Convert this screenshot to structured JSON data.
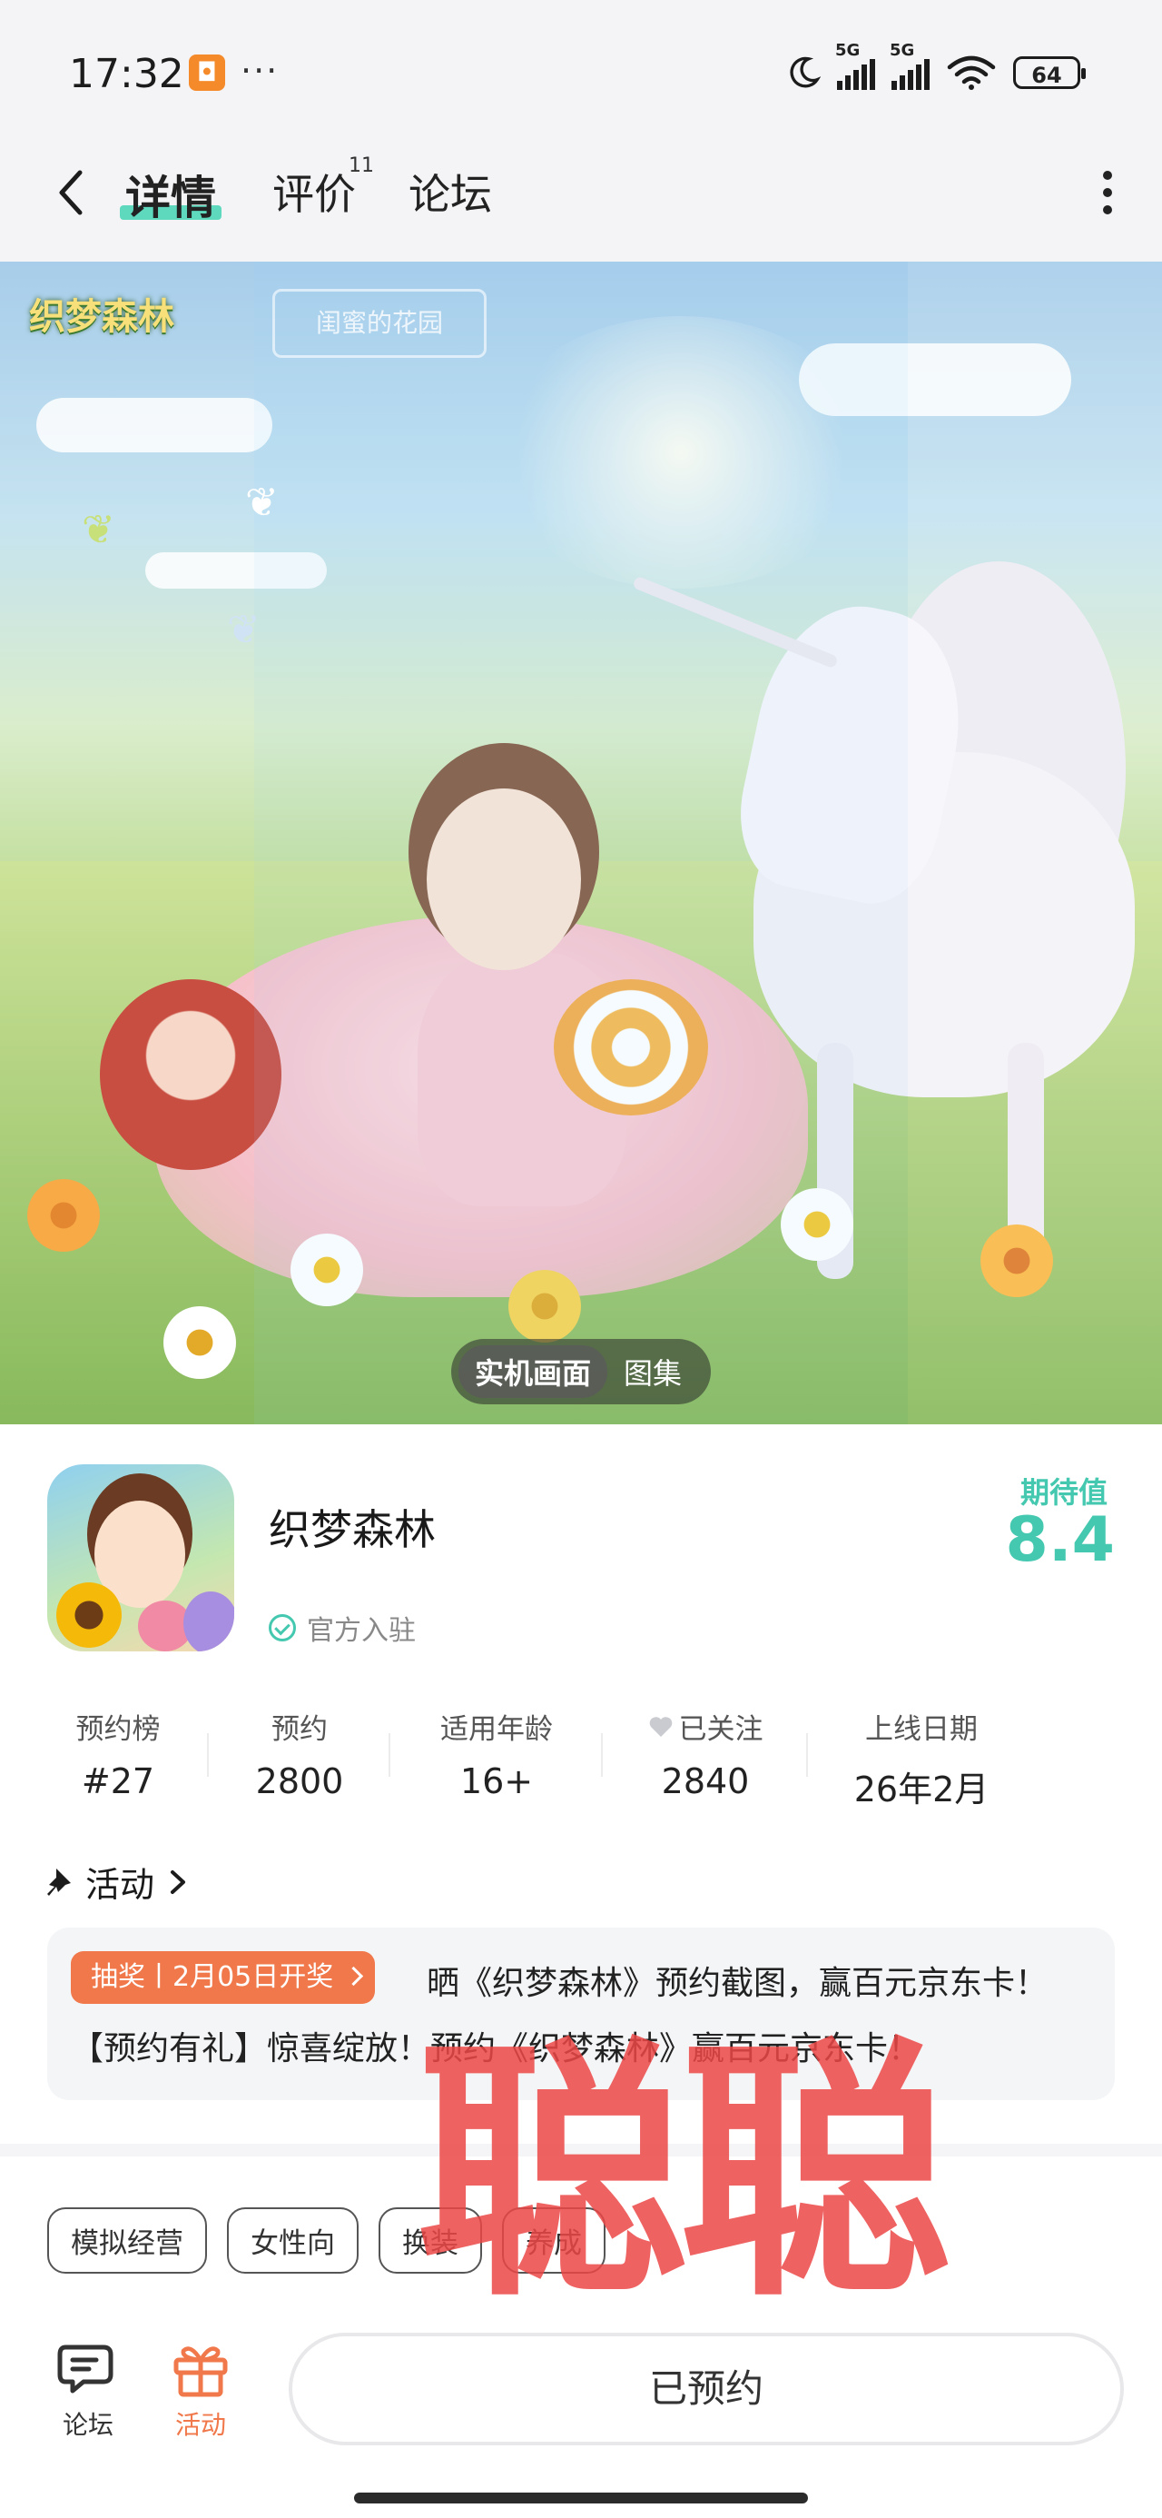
{
  "status_bar": {
    "time": "17:32",
    "signal1": "5G",
    "signal2": "5G",
    "battery": "64"
  },
  "nav": {
    "tabs": [
      {
        "label": "详情",
        "active": true
      },
      {
        "label": "评价",
        "badge": "11"
      },
      {
        "label": "论坛"
      }
    ]
  },
  "hero": {
    "logo_text": "织梦森林",
    "sign_text": "闺蜜的花园",
    "toggle": {
      "screenshots_label": "实机画面",
      "gallery_label": "图集"
    }
  },
  "app": {
    "name": "织梦森林",
    "official_label": "官方入驻",
    "expectation_label": "期待值",
    "expectation_value": "8.4"
  },
  "stats": [
    {
      "label": "预约榜",
      "value": "#27"
    },
    {
      "label": "预约",
      "value": "2800"
    },
    {
      "label": "适用年龄",
      "value": "16+"
    },
    {
      "label": "已关注",
      "value": "2840"
    },
    {
      "label": "上线日期",
      "value": "26年2月"
    }
  ],
  "activity": {
    "title": "活动",
    "badge": "抽奖丨2月05日开奖",
    "text": "晒《织梦森林》预约截图，赢百元京东卡！【预约有礼】惊喜绽放！预约《织梦森林》赢百元京东卡！"
  },
  "tags": [
    "模拟经营",
    "女性向",
    "换装",
    "养成"
  ],
  "watermark": "聪聪",
  "bottom_bar": {
    "forum_label": "论坛",
    "activity_label": "活动",
    "reserve_label": "已预约"
  },
  "colors": {
    "accent": "#45c8b0",
    "orange": "#f0784a",
    "watermark": "#ec4646"
  }
}
